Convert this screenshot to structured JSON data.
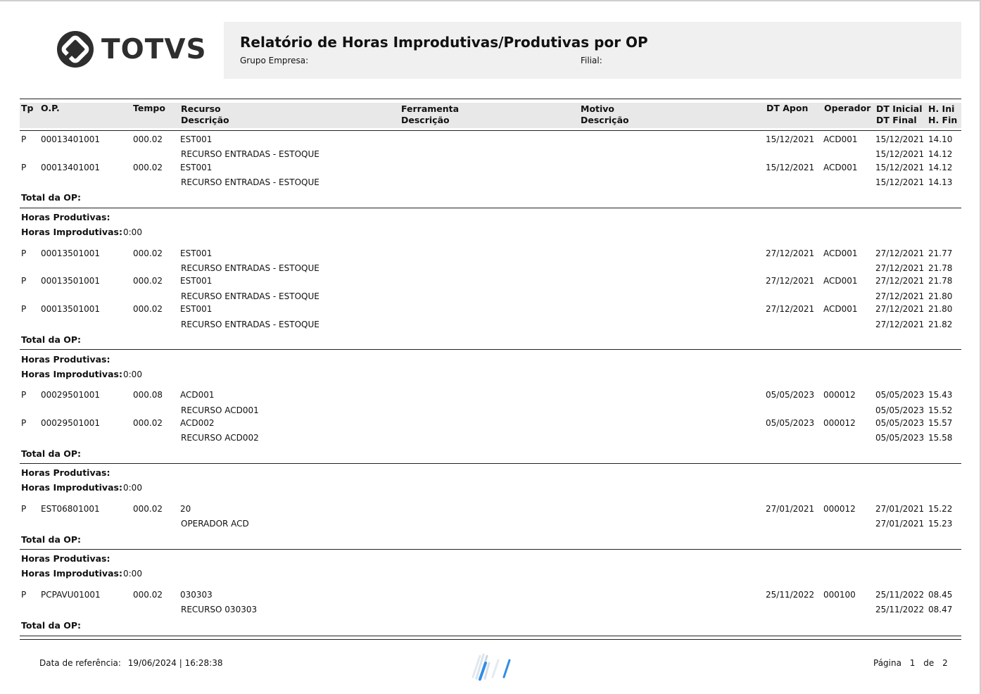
{
  "brand": {
    "name": "TOTVS"
  },
  "header": {
    "title": "Relatório de Horas Improdutivas/Produtivas por OP",
    "group_label": "Grupo Empresa:",
    "branch_label": "Filial:"
  },
  "columns": {
    "tp": "Tp",
    "op": "O.P.",
    "tempo": "Tempo",
    "recurso": "Recurso",
    "recurso_desc": "Descrição",
    "ferramenta": "Ferramenta",
    "ferramenta_desc": "Descrição",
    "motivo": "Motivo",
    "motivo_desc": "Descrição",
    "dt_apon": "DT Apon",
    "operador": "Operador",
    "dt_inicial": "DT Inicial",
    "dt_final": "DT Final",
    "h_ini": "H. Ini",
    "h_fin": "H. Fin"
  },
  "labels": {
    "total_op": "Total da OP:",
    "horas_produtivas": "Horas Produtivas:",
    "horas_improdutivas": "Horas Improdutivas:"
  },
  "groups": [
    {
      "rows": [
        {
          "tp": "P",
          "op": "00013401001",
          "tempo": "000.02",
          "recurso": "EST001",
          "descricao": "RECURSO ENTRADAS - ESTOQUE",
          "dt_apon": "15/12/2021",
          "operador": "ACD001",
          "dt_inicial": "15/12/2021",
          "h_ini": "14.10",
          "dt_final": "15/12/2021",
          "h_fin": "14.12"
        },
        {
          "tp": "P",
          "op": "00013401001",
          "tempo": "000.02",
          "recurso": "EST001",
          "descricao": "RECURSO ENTRADAS - ESTOQUE",
          "dt_apon": "15/12/2021",
          "operador": "ACD001",
          "dt_inicial": "15/12/2021",
          "h_ini": "14.12",
          "dt_final": "15/12/2021",
          "h_fin": "14.13"
        }
      ],
      "horas_improdutivas": "0:00"
    },
    {
      "rows": [
        {
          "tp": "P",
          "op": "00013501001",
          "tempo": "000.02",
          "recurso": "EST001",
          "descricao": "RECURSO ENTRADAS - ESTOQUE",
          "dt_apon": "27/12/2021",
          "operador": "ACD001",
          "dt_inicial": "27/12/2021",
          "h_ini": "21.77",
          "dt_final": "27/12/2021",
          "h_fin": "21.78"
        },
        {
          "tp": "P",
          "op": "00013501001",
          "tempo": "000.02",
          "recurso": "EST001",
          "descricao": "RECURSO ENTRADAS - ESTOQUE",
          "dt_apon": "27/12/2021",
          "operador": "ACD001",
          "dt_inicial": "27/12/2021",
          "h_ini": "21.78",
          "dt_final": "27/12/2021",
          "h_fin": "21.80"
        },
        {
          "tp": "P",
          "op": "00013501001",
          "tempo": "000.02",
          "recurso": "EST001",
          "descricao": "RECURSO ENTRADAS - ESTOQUE",
          "dt_apon": "27/12/2021",
          "operador": "ACD001",
          "dt_inicial": "27/12/2021",
          "h_ini": "21.80",
          "dt_final": "27/12/2021",
          "h_fin": "21.82"
        }
      ],
      "horas_improdutivas": "0:00"
    },
    {
      "rows": [
        {
          "tp": "P",
          "op": "00029501001",
          "tempo": "000.08",
          "recurso": "ACD001",
          "descricao": "RECURSO ACD001",
          "dt_apon": "05/05/2023",
          "operador": "000012",
          "dt_inicial": "05/05/2023",
          "h_ini": "15.43",
          "dt_final": "05/05/2023",
          "h_fin": "15.52"
        },
        {
          "tp": "P",
          "op": "00029501001",
          "tempo": "000.02",
          "recurso": "ACD002",
          "descricao": "RECURSO ACD002",
          "dt_apon": "05/05/2023",
          "operador": "000012",
          "dt_inicial": "05/05/2023",
          "h_ini": "15.57",
          "dt_final": "05/05/2023",
          "h_fin": "15.58"
        }
      ],
      "horas_improdutivas": "0:00"
    },
    {
      "rows": [
        {
          "tp": "P",
          "op": "EST06801001",
          "tempo": "000.02",
          "recurso": "20",
          "descricao": "OPERADOR ACD",
          "dt_apon": "27/01/2021",
          "operador": "000012",
          "dt_inicial": "27/01/2021",
          "h_ini": "15.22",
          "dt_final": "27/01/2021",
          "h_fin": "15.23"
        }
      ],
      "horas_improdutivas": "0:00"
    },
    {
      "rows": [
        {
          "tp": "P",
          "op": "PCPAVU01001",
          "tempo": "000.02",
          "recurso": "030303",
          "descricao": "RECURSO 030303",
          "dt_apon": "25/11/2022",
          "operador": "000100",
          "dt_inicial": "25/11/2022",
          "h_ini": "08.45",
          "dt_final": "25/11/2022",
          "h_fin": "08.47"
        }
      ]
    }
  ],
  "footer": {
    "ref_label": "Data de referência:",
    "ref_value": "19/06/2024 | 16:28:38",
    "page_label": "Página",
    "page_current": "1",
    "page_sep": "de",
    "page_total": "2"
  }
}
